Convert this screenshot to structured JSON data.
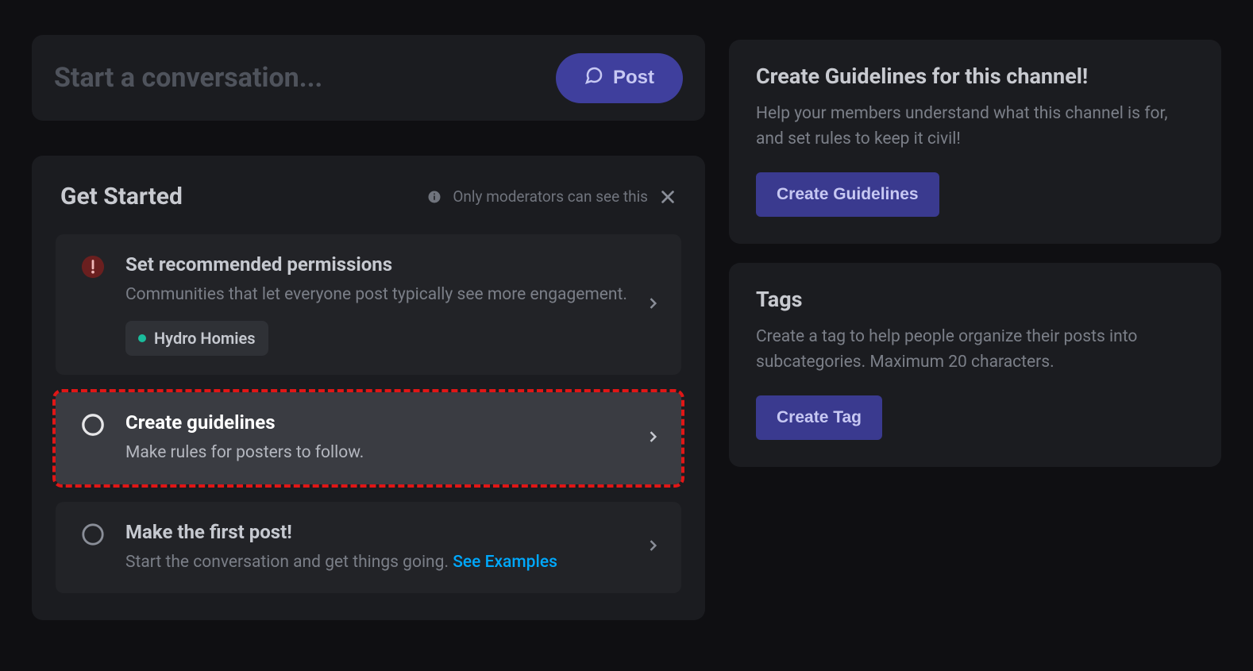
{
  "start_bar": {
    "placeholder": "Start a conversation...",
    "post_label": "Post"
  },
  "get_started": {
    "title": "Get Started",
    "moderator_note": "Only moderators can see this",
    "steps": {
      "permissions": {
        "title": "Set recommended permissions",
        "desc": "Communities that let everyone post typically see more engagement.",
        "role": "Hydro Homies"
      },
      "guidelines": {
        "title": "Create guidelines",
        "desc": "Make rules for posters to follow."
      },
      "first_post": {
        "title": "Make the first post!",
        "desc_prefix": "Start the conversation and get things going. ",
        "link_label": "See Examples"
      }
    }
  },
  "side": {
    "guidelines": {
      "title": "Create Guidelines for this channel!",
      "desc": "Help your members understand what this channel is for, and set rules to keep it civil!",
      "button": "Create Guidelines"
    },
    "tags": {
      "title": "Tags",
      "desc": "Create a tag to help people organize their posts into subcategories. Maximum 20 characters.",
      "button": "Create Tag"
    }
  }
}
